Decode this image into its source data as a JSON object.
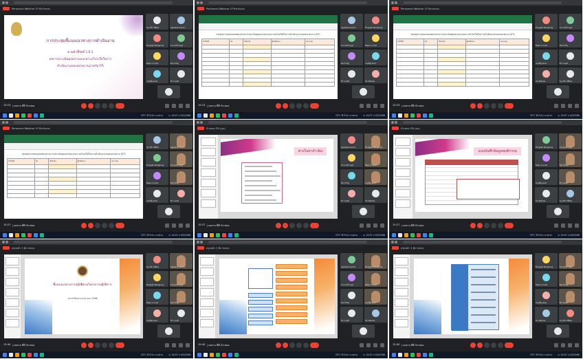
{
  "meeting": {
    "title_A": "Personnel Webinar 1F·Bn·Invns",
    "title_B": "นำเสนอ ITA (ผอ.)",
    "title_C": "สรุปหน้า 1·Bn·Invns"
  },
  "slide_intro": {
    "title": "การประชุมชี้แจงแนวทางการดำเนินงาน",
    "line1": "ตามตัวชี้วัดที่ 1.6.1",
    "line2": "ผลการประเมินคุณธรรมและความโปร่งใสในการ",
    "line3": "ดำเนินงานของหน่วยงานภาครัฐ ITA"
  },
  "sheet": {
    "heading": "สรุปผลการตอบแบบสอบถามการประเมินคุณธรรมและความโปร่งใสในการดำเนินงานของหน่วยงาน (IIT)",
    "cols": [
      "ตัวชี้วัดที่",
      "ข้อ",
      "ชื่อหัวข้อ",
      "ผู้รับผิดชอบ",
      "หมายเหตุ"
    ]
  },
  "slide_pink": {
    "banner": "ต่างในขาดำเนิน"
  },
  "slide_pink2": {
    "banner": "แบบบันทึกข้อมูลพฤติกรรม"
  },
  "slide_orange": {
    "t1": "ชี้แจงแนวทางการปฏิบัติตามโครงการปฏิบัติการ",
    "t2": "ประจำปีงบประมาณ พ.ศ. 2566"
  },
  "participants": [
    "ครู ปวิช ทวิสินพ",
    "ครูสมพงศ์ หนองบัว",
    "Pongsak Wongsong",
    "ชาย สนธิราษฎร์",
    "นิลพล นามวงค์",
    "นิพ จำเริญ",
    "เจนเพ็ญ สมพร",
    "ชิวา ทองดี",
    "Ch. Banlue"
  ],
  "controls": {
    "time_1": "15:23",
    "time_2": "15:27",
    "time_3": "15:40",
    "label": "| ผลงาน ที่ดี นำเสนอ"
  },
  "taskbar": {
    "weather": "33°C ฟ้าโปร่ง บางส่วน",
    "clock": "ค. 16:07 ล 9/5/2566"
  },
  "colors": {
    "meet_bg": "#202124",
    "leave_red": "#ea4335",
    "excel_green": "#217346",
    "ppt_orange": "#f58b3b"
  }
}
